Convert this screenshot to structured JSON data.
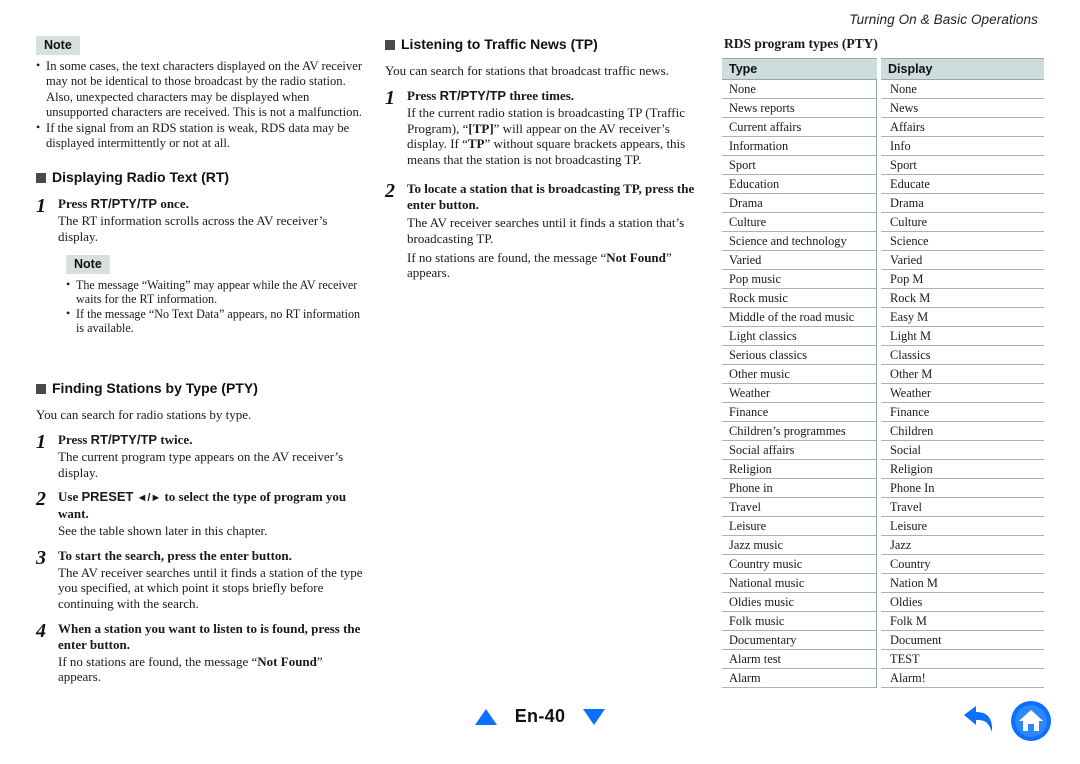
{
  "running_head": "Turning On & Basic Operations",
  "column_left": {
    "note_top": {
      "badge": "Note",
      "items": [
        "In some cases, the text characters displayed on the AV receiver may not be identical to those broadcast by the radio station. Also, unexpected characters may be displayed when unsupported characters are received. This is not a malfunction.",
        "If the signal from an RDS station is weak, RDS data may be displayed intermittently or not at all."
      ]
    },
    "section_rt": {
      "heading": "Displaying Radio Text (RT)",
      "steps": [
        {
          "num": "1",
          "title_pre": "Press ",
          "title_key": "RT/PTY/TP",
          "title_post": " once.",
          "text": "The RT information scrolls across the AV receiver’s display."
        }
      ],
      "note": {
        "badge": "Note",
        "items": [
          "The message “Waiting” may appear while the AV receiver waits for the RT information.",
          "If the message “No Text Data” appears, no RT information is available."
        ]
      }
    },
    "section_pty": {
      "heading": "Finding Stations by Type (PTY)",
      "intro": "You can search for radio stations by type.",
      "steps": [
        {
          "num": "1",
          "title_pre": "Press ",
          "title_key": "RT/PTY/TP",
          "title_post": " twice.",
          "text": "The current program type appears on the AV receiver’s display."
        },
        {
          "num": "2",
          "title_pre": "Use ",
          "title_key": "PRESET",
          "title_arrows": " ◄/► ",
          "title_post": "to select the type of program you want.",
          "text": "See the table shown later in this chapter."
        },
        {
          "num": "3",
          "title_plain": "To start the search, press the enter button.",
          "text": "The AV receiver searches until it finds a station of the type you specified, at which point it stops briefly before continuing with the search."
        },
        {
          "num": "4",
          "title_plain": "When a station you want to listen to is found, press the enter button.",
          "text_pre": "If no stations are found, the message “",
          "text_bold": "Not Found",
          "text_post": "” appears."
        }
      ]
    }
  },
  "column_middle": {
    "section_tp": {
      "heading": "Listening to Traffic News (TP)",
      "intro": "You can search for stations that broadcast traffic news.",
      "steps": [
        {
          "num": "1",
          "title_pre": "Press ",
          "title_key": "RT/PTY/TP",
          "title_post": " three times.",
          "text_a": "If the current radio station is broadcasting TP (Traffic Program), “",
          "text_b": "[TP]",
          "text_c": "” will appear on the AV receiver’s display. If “",
          "text_d": "TP",
          "text_e": "” without square brackets appears, this means that the station is not broadcasting TP."
        },
        {
          "num": "2",
          "title_plain": "To locate a station that is broadcasting TP, press the enter button.",
          "text": "The AV receiver searches until it finds a station that’s broadcasting TP.",
          "text2_pre": "If no stations are found, the message “",
          "text2_bold": "Not Found",
          "text2_post": "” appears."
        }
      ]
    }
  },
  "column_right": {
    "table_title": "RDS program types (PTY)",
    "headers": [
      "Type",
      "Display"
    ],
    "rows": [
      [
        "None",
        "None"
      ],
      [
        "News reports",
        "News"
      ],
      [
        "Current affairs",
        "Affairs"
      ],
      [
        "Information",
        "Info"
      ],
      [
        "Sport",
        "Sport"
      ],
      [
        "Education",
        "Educate"
      ],
      [
        "Drama",
        "Drama"
      ],
      [
        "Culture",
        "Culture"
      ],
      [
        "Science and technology",
        "Science"
      ],
      [
        "Varied",
        "Varied"
      ],
      [
        "Pop music",
        "Pop M"
      ],
      [
        "Rock music",
        "Rock M"
      ],
      [
        "Middle of the road music",
        "Easy M"
      ],
      [
        "Light classics",
        "Light M"
      ],
      [
        "Serious classics",
        "Classics"
      ],
      [
        "Other music",
        "Other M"
      ],
      [
        "Weather",
        "Weather"
      ],
      [
        "Finance",
        "Finance"
      ],
      [
        "Children’s programmes",
        "Children"
      ],
      [
        "Social affairs",
        "Social"
      ],
      [
        "Religion",
        "Religion"
      ],
      [
        "Phone in",
        "Phone In"
      ],
      [
        "Travel",
        "Travel"
      ],
      [
        "Leisure",
        "Leisure"
      ],
      [
        "Jazz music",
        "Jazz"
      ],
      [
        "Country music",
        "Country"
      ],
      [
        "National music",
        "Nation M"
      ],
      [
        "Oldies music",
        "Oldies"
      ],
      [
        "Folk music",
        "Folk M"
      ],
      [
        "Documentary",
        "Document"
      ],
      [
        "Alarm test",
        "TEST"
      ],
      [
        "Alarm",
        "Alarm!"
      ]
    ]
  },
  "footer": {
    "page_label": "En-40",
    "prev_icon": "triangle-up-icon",
    "next_icon": "triangle-down-icon",
    "back_icon": "back-arrow-icon",
    "home_icon": "home-icon",
    "accent_color": "#0b6fff"
  }
}
